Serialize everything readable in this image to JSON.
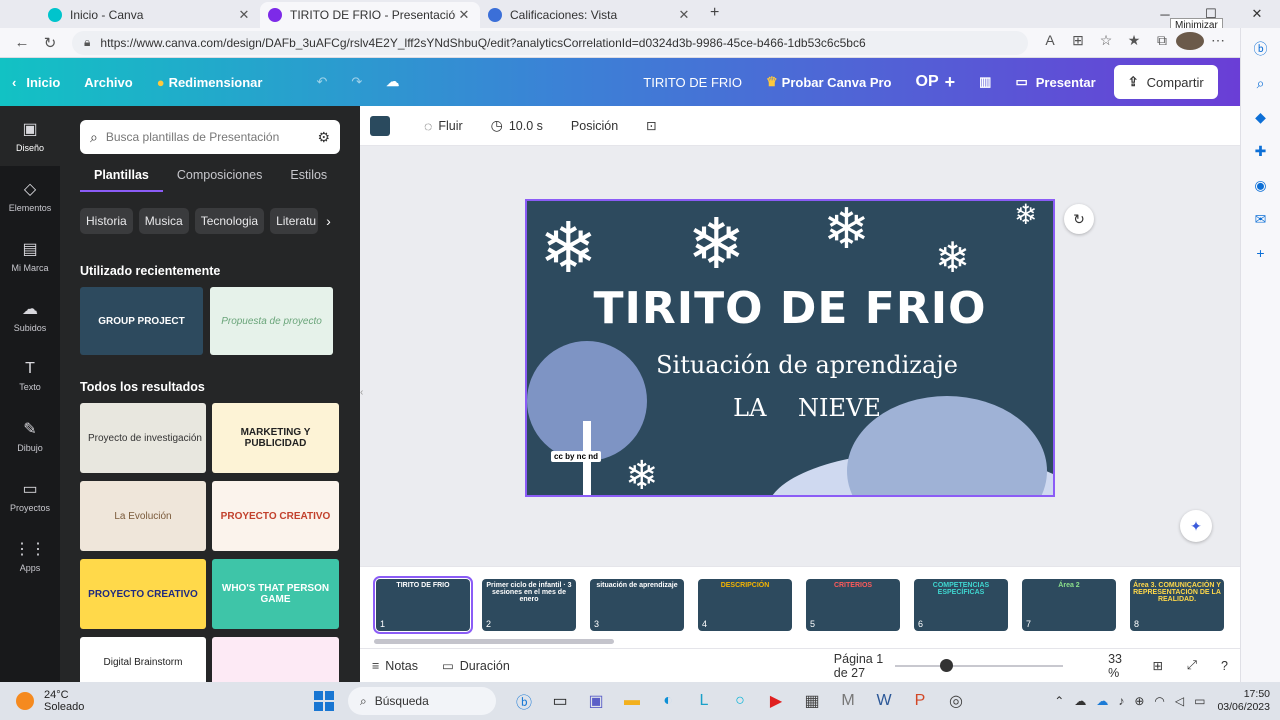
{
  "browser": {
    "tabs": [
      {
        "title": "Inicio - Canva",
        "color": "#00c4cc"
      },
      {
        "title": "TIRITO DE FRIO - Presentación",
        "color": "#7d2ae8"
      },
      {
        "title": "Calificaciones: Vista",
        "color": "#3b6fd8"
      }
    ],
    "new_tab": "+",
    "url": "https://www.canva.com/design/DAFb_3uAFCg/rslv4E2Y_lff2sYNdShbuQ/edit?analyticsCorrelationId=d0324d3b-9986-45ce-b466-1db53c6c5bc6",
    "tooltip": "Minimizar"
  },
  "canva_top": {
    "home": "Inicio",
    "file": "Archivo",
    "resize": "Redimensionar",
    "doc_title": "TIRITO DE FRIO",
    "try_pro": "Probar Canva Pro",
    "avatar": "OP",
    "present": "Presentar",
    "share": "Compartir"
  },
  "rail": [
    {
      "label": "Diseño",
      "icon": "layout-icon",
      "glyph": "▣"
    },
    {
      "label": "Elementos",
      "icon": "shapes-icon",
      "glyph": "◇"
    },
    {
      "label": "Mi Marca",
      "icon": "brand-icon",
      "glyph": "▤"
    },
    {
      "label": "Subidos",
      "icon": "upload-icon",
      "glyph": "☁"
    },
    {
      "label": "Texto",
      "icon": "text-icon",
      "glyph": "T"
    },
    {
      "label": "Dibujo",
      "icon": "draw-icon",
      "glyph": "✎"
    },
    {
      "label": "Proyectos",
      "icon": "folder-icon",
      "glyph": "▭"
    },
    {
      "label": "Apps",
      "icon": "apps-icon",
      "glyph": "⋮⋮"
    }
  ],
  "panel": {
    "search_placeholder": "Busca plantillas de Presentación",
    "tabs": [
      "Plantillas",
      "Composiciones",
      "Estilos"
    ],
    "chips": [
      "Historia",
      "Musica",
      "Tecnologia",
      "Literatu"
    ],
    "recent_title": "Utilizado recientemente",
    "recent": [
      {
        "label": "GROUP PROJECT",
        "bg": "#2d4a5e",
        "fg": "#ffffff"
      },
      {
        "label": "Propuesta de proyecto",
        "bg": "#e6f2ea",
        "fg": "#6aa57a"
      }
    ],
    "all_title": "Todos los resultados",
    "results": [
      {
        "label": "Proyecto de investigación",
        "bg": "#e8e7df",
        "fg": "#333333"
      },
      {
        "label": "MARKETING Y PUBLICIDAD",
        "bg": "#fdf3d6",
        "fg": "#222222"
      },
      {
        "label": "La Evolución",
        "bg": "#efe6da",
        "fg": "#7a5a3a"
      },
      {
        "label": "PROYECTO CREATIVO",
        "bg": "#fbf3ec",
        "fg": "#c2412d"
      },
      {
        "label": "PROYECTO CREATIVO",
        "bg": "#ffd94a",
        "fg": "#1f2a80"
      },
      {
        "label": "WHO'S THAT PERSON GAME",
        "bg": "#3ec5a8",
        "fg": "#ffffff"
      },
      {
        "label": "Digital Brainstorm",
        "bg": "#ffffff",
        "fg": "#222222"
      },
      {
        "label": "",
        "bg": "#fdeaf5",
        "fg": "#222222"
      }
    ]
  },
  "subbar": {
    "swatch_color": "#2a4a5e",
    "animate": "Fluir",
    "duration": "10.0 s",
    "position": "Posición"
  },
  "slide": {
    "title": "TIRITO DE FRIO",
    "subtitle": "Situación de aprendizaje",
    "subtitle2": "LA NIEVE",
    "badge": "cc by nc nd",
    "bg": "#2d4a5e"
  },
  "filmstrip": [
    {
      "num": "1",
      "text": "TIRITO DE FRIO",
      "bg": "#2d4a5e"
    },
    {
      "num": "2",
      "text": "Primer ciclo de infantil · 3 sesiones en el mes de enero",
      "bg": "#2d4a5e"
    },
    {
      "num": "3",
      "text": "situación de aprendizaje",
      "bg": "#2d4a5e"
    },
    {
      "num": "4",
      "text": "DESCRIPCIÓN",
      "bg": "#2d4a5e"
    },
    {
      "num": "5",
      "text": "CRITERIOS",
      "bg": "#2d4a5e"
    },
    {
      "num": "6",
      "text": "COMPETENCIAS ESPECÍFICAS",
      "bg": "#2d4a5e"
    },
    {
      "num": "7",
      "text": "Área 2",
      "bg": "#2d4a5e"
    },
    {
      "num": "8",
      "text": "Área 3. COMUNICACIÓN Y REPRESENTACIÓN DE LA REALIDAD.",
      "bg": "#2d4a5e"
    }
  ],
  "footer": {
    "notes": "Notas",
    "duration": "Duración",
    "page": "Página 1 de 27",
    "zoom": "33 %",
    "zoom_value": 0.33
  },
  "taskbar": {
    "temp": "24°C",
    "weather": "Soleado",
    "search": "Búsqueda",
    "time": "17:50",
    "date": "03/06/2023"
  }
}
